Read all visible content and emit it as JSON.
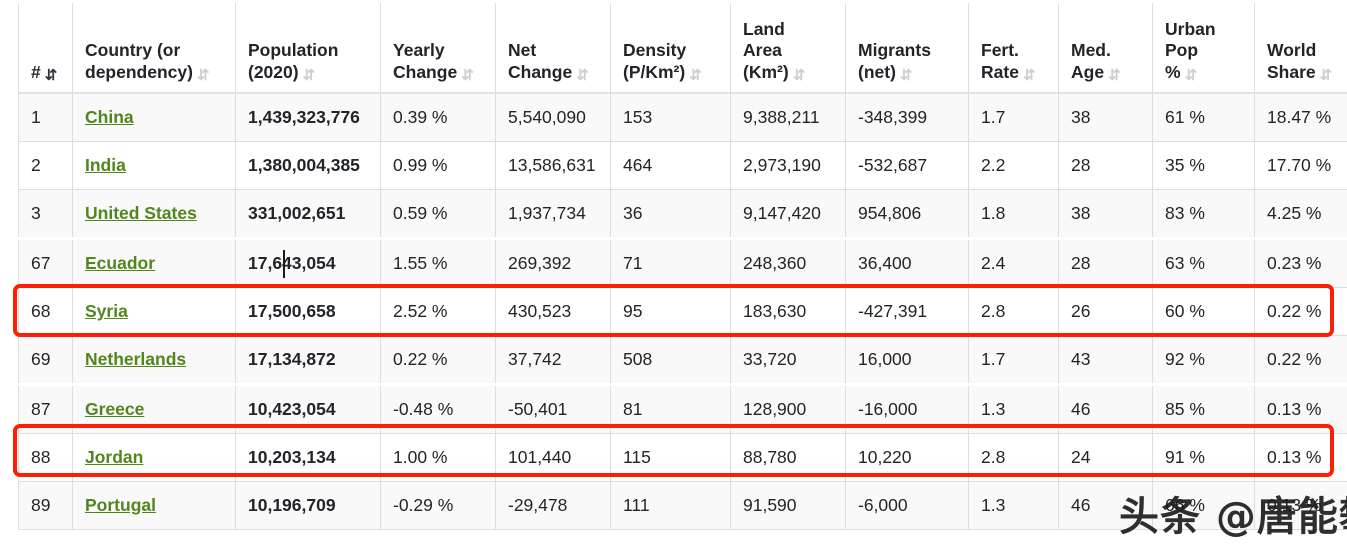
{
  "table": {
    "columns": [
      {
        "key": "rank",
        "label": "#",
        "sort_icon": "sort-desc-icon",
        "sort_active": true
      },
      {
        "key": "name",
        "label": "Country (or dependency)",
        "sort_icon": "sort-both-icon",
        "sort_active": false
      },
      {
        "key": "pop",
        "label": "Population (2020)",
        "sort_icon": "sort-both-icon",
        "sort_active": false
      },
      {
        "key": "yearly",
        "label": "Yearly Change",
        "sort_icon": "sort-both-icon",
        "sort_active": false
      },
      {
        "key": "net",
        "label": "Net Change",
        "sort_icon": "sort-both-icon",
        "sort_active": false
      },
      {
        "key": "dens",
        "label": "Density (P/Km²)",
        "sort_icon": "sort-both-icon",
        "sort_active": false
      },
      {
        "key": "land",
        "label": "Land Area (Km²)",
        "sort_icon": "sort-both-icon",
        "sort_active": false
      },
      {
        "key": "mig",
        "label": "Migrants (net)",
        "sort_icon": "sort-both-icon",
        "sort_active": false
      },
      {
        "key": "fert",
        "label": "Fert. Rate",
        "sort_icon": "sort-both-icon",
        "sort_active": false
      },
      {
        "key": "age",
        "label": "Med. Age",
        "sort_icon": "sort-both-icon",
        "sort_active": false
      },
      {
        "key": "urban",
        "label": "Urban Pop %",
        "sort_icon": "sort-both-icon",
        "sort_active": false
      },
      {
        "key": "world",
        "label": "World Share",
        "sort_icon": "sort-both-icon",
        "sort_active": false
      }
    ],
    "header_lines": {
      "rank": [
        "#"
      ],
      "name": [
        "Country (or",
        "dependency)"
      ],
      "pop": [
        "Population",
        "(2020)"
      ],
      "yearly": [
        "Yearly",
        "Change"
      ],
      "net": [
        "Net",
        "Change"
      ],
      "dens": [
        "Density",
        "(P/Km²)"
      ],
      "land": [
        "Land",
        "Area",
        "(Km²)"
      ],
      "mig": [
        "Migrants",
        "(net)"
      ],
      "fert": [
        "Fert.",
        "Rate"
      ],
      "age": [
        "Med.",
        "Age"
      ],
      "urban": [
        "Urban",
        "Pop",
        "%"
      ],
      "world": [
        "World",
        "Share"
      ]
    },
    "rows": [
      {
        "rank": "1",
        "name": "China",
        "pop": "1,439,323,776",
        "yearly": "0.39 %",
        "net": "5,540,090",
        "dens": "153",
        "land": "9,388,211",
        "mig": "-348,399",
        "fert": "1.7",
        "age": "38",
        "urban": "61 %",
        "world": "18.47 %",
        "stripe": "odd",
        "highlight": false,
        "seam": false
      },
      {
        "rank": "2",
        "name": "India",
        "pop": "1,380,004,385",
        "yearly": "0.99 %",
        "net": "13,586,631",
        "dens": "464",
        "land": "2,973,190",
        "mig": "-532,687",
        "fert": "2.2",
        "age": "28",
        "urban": "35 %",
        "world": "17.70 %",
        "stripe": "even",
        "highlight": false,
        "seam": false
      },
      {
        "rank": "3",
        "name": "United States",
        "pop": "331,002,651",
        "yearly": "0.59 %",
        "net": "1,937,734",
        "dens": "36",
        "land": "9,147,420",
        "mig": "954,806",
        "fert": "1.8",
        "age": "38",
        "urban": "83 %",
        "world": "4.25 %",
        "stripe": "odd",
        "highlight": false,
        "seam": false
      },
      {
        "rank": "67",
        "name": "Ecuador",
        "pop": "17,643,054",
        "yearly": "1.55 %",
        "net": "269,392",
        "dens": "71",
        "land": "248,360",
        "mig": "36,400",
        "fert": "2.4",
        "age": "28",
        "urban": "63 %",
        "world": "0.23 %",
        "stripe": "odd",
        "highlight": false,
        "seam": true
      },
      {
        "rank": "68",
        "name": "Syria",
        "pop": "17,500,658",
        "yearly": "2.52 %",
        "net": "430,523",
        "dens": "95",
        "land": "183,630",
        "mig": "-427,391",
        "fert": "2.8",
        "age": "26",
        "urban": "60 %",
        "world": "0.22 %",
        "stripe": "even",
        "highlight": true,
        "seam": false
      },
      {
        "rank": "69",
        "name": "Netherlands",
        "pop": "17,134,872",
        "yearly": "0.22 %",
        "net": "37,742",
        "dens": "508",
        "land": "33,720",
        "mig": "16,000",
        "fert": "1.7",
        "age": "43",
        "urban": "92 %",
        "world": "0.22 %",
        "stripe": "odd",
        "highlight": false,
        "seam": false
      },
      {
        "rank": "87",
        "name": "Greece",
        "pop": "10,423,054",
        "yearly": "-0.48 %",
        "net": "-50,401",
        "dens": "81",
        "land": "128,900",
        "mig": "-16,000",
        "fert": "1.3",
        "age": "46",
        "urban": "85 %",
        "world": "0.13 %",
        "stripe": "odd",
        "highlight": false,
        "seam": true
      },
      {
        "rank": "88",
        "name": "Jordan",
        "pop": "10,203,134",
        "yearly": "1.00 %",
        "net": "101,440",
        "dens": "115",
        "land": "88,780",
        "mig": "10,220",
        "fert": "2.8",
        "age": "24",
        "urban": "91 %",
        "world": "0.13 %",
        "stripe": "even",
        "highlight": true,
        "seam": false
      },
      {
        "rank": "89",
        "name": "Portugal",
        "pop": "10,196,709",
        "yearly": "-0.29 %",
        "net": "-29,478",
        "dens": "111",
        "land": "91,590",
        "mig": "-6,000",
        "fert": "1.3",
        "age": "46",
        "urban": "66 %",
        "world": "0.13 %",
        "stripe": "odd",
        "highlight": false,
        "seam": false
      }
    ]
  },
  "annotations": {
    "highlight_color": "#fa1f05",
    "highlighted_rows": [
      "68",
      "88"
    ],
    "caret_in_cell": "17,643,054"
  },
  "watermark": {
    "text": "头条 @唐能攀"
  },
  "colors": {
    "country_link": "#51861c",
    "row_stripe": "#f9f9f9",
    "row_plain": "#ffffff",
    "border": "#dddddd",
    "text": "#212529",
    "highlight": "#fa1f05"
  }
}
